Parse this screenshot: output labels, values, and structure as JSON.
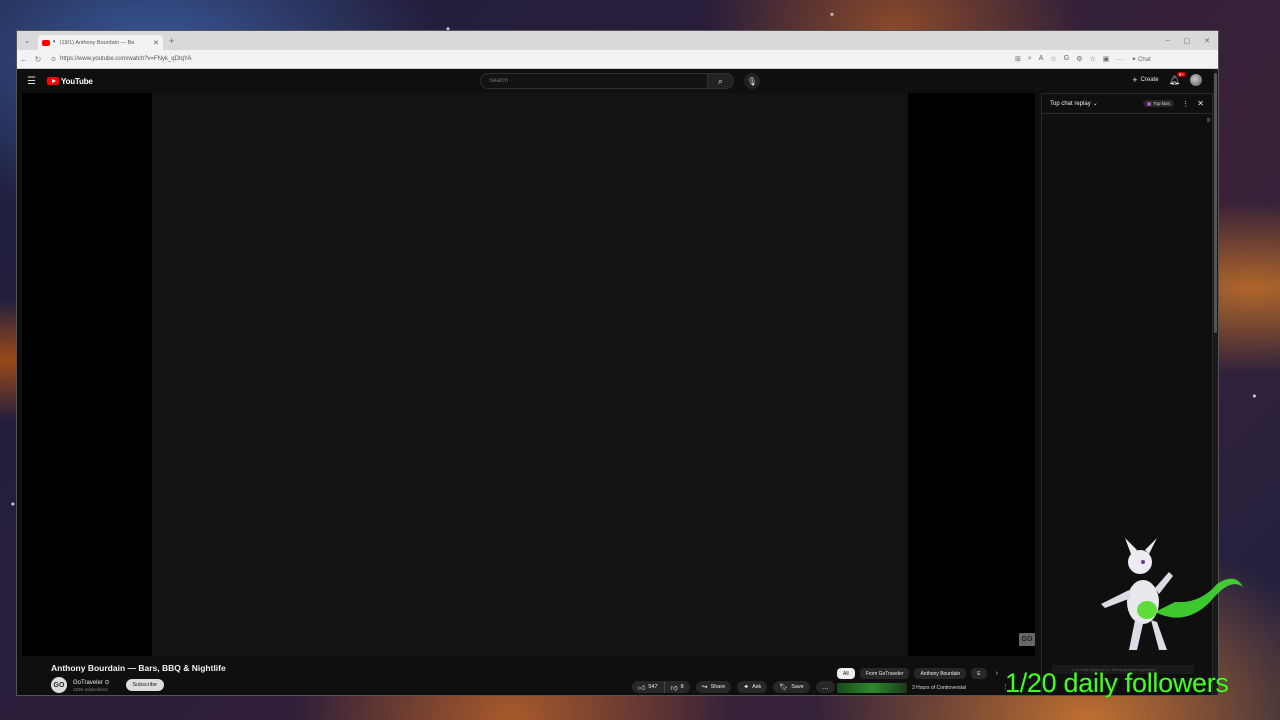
{
  "browser": {
    "tab_title": "(19/1) Anthony Bourdain — Ba",
    "new_tab": "+",
    "url": "https://www.youtube.com/watch?v=FNyk_qDtqYA",
    "sidebar_label": "Chat"
  },
  "youtube": {
    "logo_text": "YouTube",
    "search_placeholder": "Search",
    "create_label": "Create",
    "notification_count": "9+"
  },
  "player": {
    "watermark": "GO"
  },
  "chat": {
    "title": "Top chat replay",
    "top_fans_label": "Top fans",
    "notice": "Live chat replay is on. Messages that appeared"
  },
  "video": {
    "title": "Anthony Bourdain — Bars, BBQ & Nightlife",
    "channel_name": "GoTraveler",
    "channel_avatar_text": "GO",
    "verified_mark": "⊙",
    "subscribers": "153K subscribers",
    "subscribe_label": "Subscribe",
    "likes": "547",
    "dislikes": "8",
    "share_label": "Share",
    "ask_label": "Ask",
    "save_label": "Save"
  },
  "chips": [
    "All",
    "From GoTraveler",
    "Anthony Bourdain",
    "E"
  ],
  "recommendation": {
    "title": "3 Hours of Controversial"
  },
  "overlay": {
    "followers_text": "1/20 daily followers"
  },
  "colors": {
    "youtube_red": "#ff0000",
    "followers_green": "#44ff22",
    "page_bg": "#0f0f0f"
  }
}
